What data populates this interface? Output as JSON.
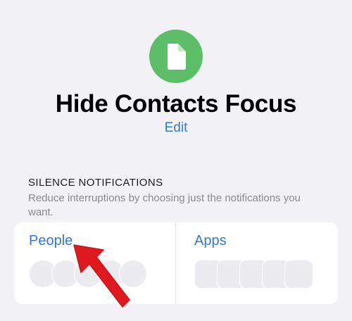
{
  "focus": {
    "icon": "document-icon",
    "accent_color": "#5cbf67",
    "title": "Hide Contacts Focus",
    "edit_label": "Edit"
  },
  "silence": {
    "header": "SILENCE NOTIFICATIONS",
    "description": "Reduce interruptions by choosing just the notifications you want."
  },
  "card": {
    "people_label": "People",
    "apps_label": "Apps"
  },
  "colors": {
    "link": "#3478d6",
    "arrow": "#e0191f",
    "background": "#f2f2f6"
  }
}
